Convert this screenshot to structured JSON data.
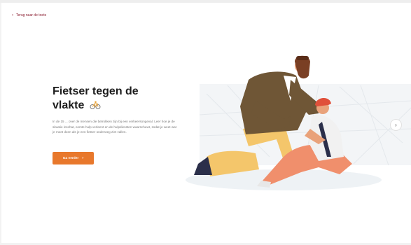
{
  "nav": {
    "back_label": "Terug naar de toets",
    "back_icon": "chevron-left-icon"
  },
  "hero": {
    "title": "Fietser tegen de vlakte",
    "title_icon": "cyclist-icon",
    "body": "In de 15 ... over de mensen die betrokken zijn bij een verkeersongeval. Leer hoe je de situatie inschat, eerste hulp verleent en de hulpdiensten waarschuwt, zodat je weet wat je moet doen als je een fietser onderweg ziet vallen.",
    "cta_label": "Ga verder",
    "cta_icon": "chevron-right-icon"
  },
  "carousel": {
    "next_icon": "chevron-right-icon"
  },
  "illustration": {
    "name": "first-aid-cyclist-illustration"
  },
  "colors": {
    "accent": "#e8782c",
    "link": "#8a1c2f",
    "title": "#1c1c1c",
    "body_text": "#7a7a7a",
    "jacket": "#6f5636",
    "trousers": "#f4c66b",
    "helmet": "#e0503a",
    "cyclist_pants": "#f08f6c"
  }
}
